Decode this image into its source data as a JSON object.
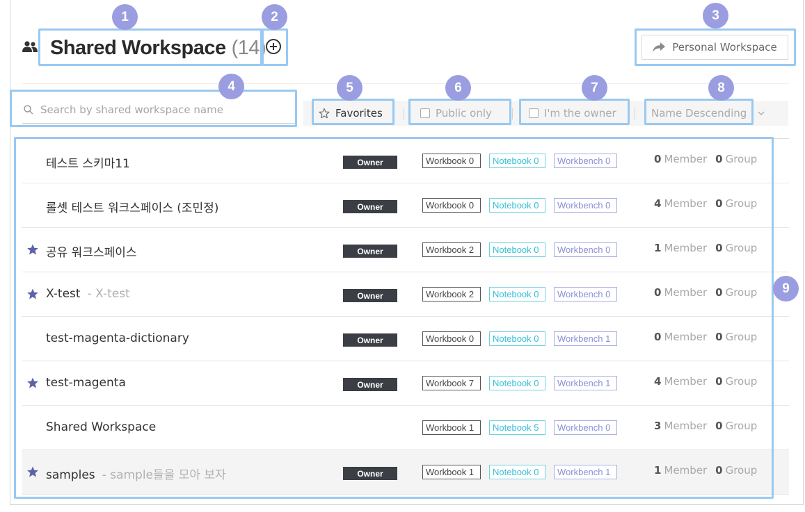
{
  "header": {
    "title": "Shared Workspace",
    "count": "(14)",
    "personal_button": "Personal Workspace"
  },
  "search": {
    "placeholder": "Search by shared workspace name"
  },
  "filters": {
    "favorites": "Favorites",
    "public_only": "Public only",
    "owner_only": "I'm the owner",
    "sort": "Name Descending"
  },
  "annotations": [
    "1",
    "2",
    "3",
    "4",
    "5",
    "6",
    "7",
    "8",
    "9"
  ],
  "workspaces": [
    {
      "name": "테스트 스키마11",
      "desc": "",
      "favorite": false,
      "owner": "Owner",
      "workbook": "Workbook 0",
      "notebook": "Notebook 0",
      "workbench": "Workbench 0",
      "members": "0",
      "member_label": "Member",
      "groups": "0",
      "group_label": "Group"
    },
    {
      "name": "롤셋 테스트 워크스페이스 (조민정)",
      "desc": "",
      "favorite": false,
      "owner": "Owner",
      "workbook": "Workbook 0",
      "notebook": "Notebook 0",
      "workbench": "Workbench 0",
      "members": "4",
      "member_label": "Member",
      "groups": "0",
      "group_label": "Group"
    },
    {
      "name": "공유 워크스페이스",
      "desc": "",
      "favorite": true,
      "owner": "Owner",
      "workbook": "Workbook 2",
      "notebook": "Notebook 0",
      "workbench": "Workbench 0",
      "members": "1",
      "member_label": "Member",
      "groups": "0",
      "group_label": "Group"
    },
    {
      "name": "X-test",
      "desc": "- X-test",
      "favorite": true,
      "owner": "Owner",
      "workbook": "Workbook 2",
      "notebook": "Notebook 0",
      "workbench": "Workbench 0",
      "members": "0",
      "member_label": "Member",
      "groups": "0",
      "group_label": "Group"
    },
    {
      "name": "test-magenta-dictionary",
      "desc": "",
      "favorite": false,
      "owner": "Owner",
      "workbook": "Workbook 0",
      "notebook": "Notebook 0",
      "workbench": "Workbench 1",
      "members": "0",
      "member_label": "Member",
      "groups": "0",
      "group_label": "Group"
    },
    {
      "name": "test-magenta",
      "desc": "",
      "favorite": true,
      "owner": "Owner",
      "workbook": "Workbook 7",
      "notebook": "Notebook 0",
      "workbench": "Workbench 1",
      "members": "4",
      "member_label": "Member",
      "groups": "0",
      "group_label": "Group"
    },
    {
      "name": "Shared Workspace",
      "desc": "",
      "favorite": false,
      "owner": "",
      "workbook": "Workbook 1",
      "notebook": "Notebook 5",
      "workbench": "Workbench 0",
      "members": "3",
      "member_label": "Member",
      "groups": "0",
      "group_label": "Group"
    },
    {
      "name": "samples",
      "desc": "- sample들을 모아 보자",
      "favorite": true,
      "owner": "Owner",
      "workbook": "Workbook 1",
      "notebook": "Notebook 0",
      "workbench": "Workbench 1",
      "members": "1",
      "member_label": "Member",
      "groups": "0",
      "group_label": "Group"
    }
  ],
  "colors": {
    "annotation_box": "#99c9f0",
    "annotation_badge": "#9a9ee0",
    "owner_badge": "#3b3e44",
    "notebook": "#35bfd4",
    "workbench": "#8a8fd6",
    "star": "#5b62a8"
  }
}
